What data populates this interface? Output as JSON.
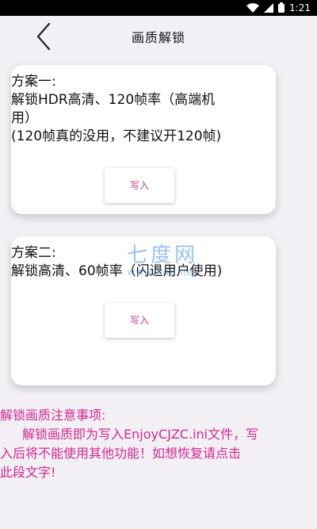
{
  "status_bar": {
    "time": "1:21",
    "icons": [
      "wifi-icon",
      "signal-icon",
      "battery-icon"
    ]
  },
  "header": {
    "title": "画质解锁",
    "back_icon": "chevron-left-icon"
  },
  "plans": [
    {
      "lines": [
        "方案一:",
        "解锁HDR高清、120帧率（高端机",
        "用）",
        "(120帧真的没用，不建议开120帧)"
      ],
      "button_label": "写入"
    },
    {
      "lines": [
        "方案二:",
        "解锁高清、60帧率（闪退用户使用)"
      ],
      "button_label": "写入"
    }
  ],
  "watermark": {
    "main": "七度网",
    "sub": "www.7do.net"
  },
  "notice": {
    "title": "解锁画质注意事项:",
    "body_line1": "解锁画质即为写入EnjoyCJZC.ini文件，写",
    "body_line2": "入后将不能使用其他功能！如想恢复请点击",
    "body_line3": "此段文字!"
  },
  "colors": {
    "accent_pink": "#d6278f",
    "button_text": "#c2378e",
    "background": "#f2f0f4"
  }
}
